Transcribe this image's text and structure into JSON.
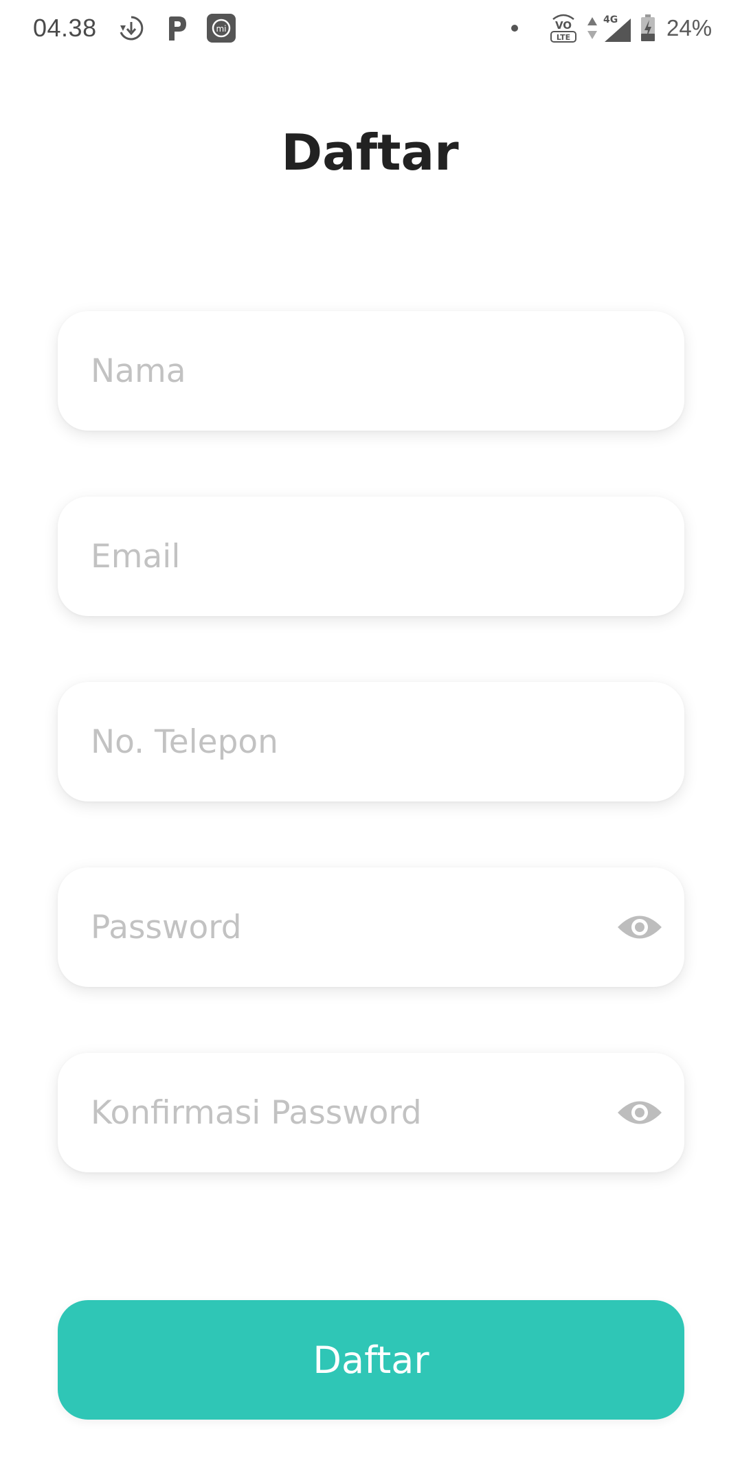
{
  "status_bar": {
    "time": "04.38",
    "battery_percent": "24%",
    "network": "4G",
    "volte_label": "VO LTE",
    "icons": [
      "download-sync-icon",
      "p-app-icon",
      "mi-app-icon",
      "dot-icon",
      "volte-icon",
      "data-arrows-icon",
      "signal-4g-icon",
      "battery-charging-icon"
    ]
  },
  "page": {
    "title": "Daftar"
  },
  "form": {
    "name": {
      "placeholder": "Nama",
      "value": ""
    },
    "email": {
      "placeholder": "Email",
      "value": ""
    },
    "phone": {
      "placeholder": "No. Telepon",
      "value": ""
    },
    "password": {
      "placeholder": "Password",
      "value": "",
      "icon": "eye-icon"
    },
    "confirm_password": {
      "placeholder": "Konfirmasi Password",
      "value": "",
      "icon": "eye-icon"
    }
  },
  "submit": {
    "label": "Daftar"
  },
  "colors": {
    "accent": "#2fc6b6",
    "title": "#222222",
    "placeholder": "#c2c2c2",
    "icon": "#bdbdbd"
  }
}
